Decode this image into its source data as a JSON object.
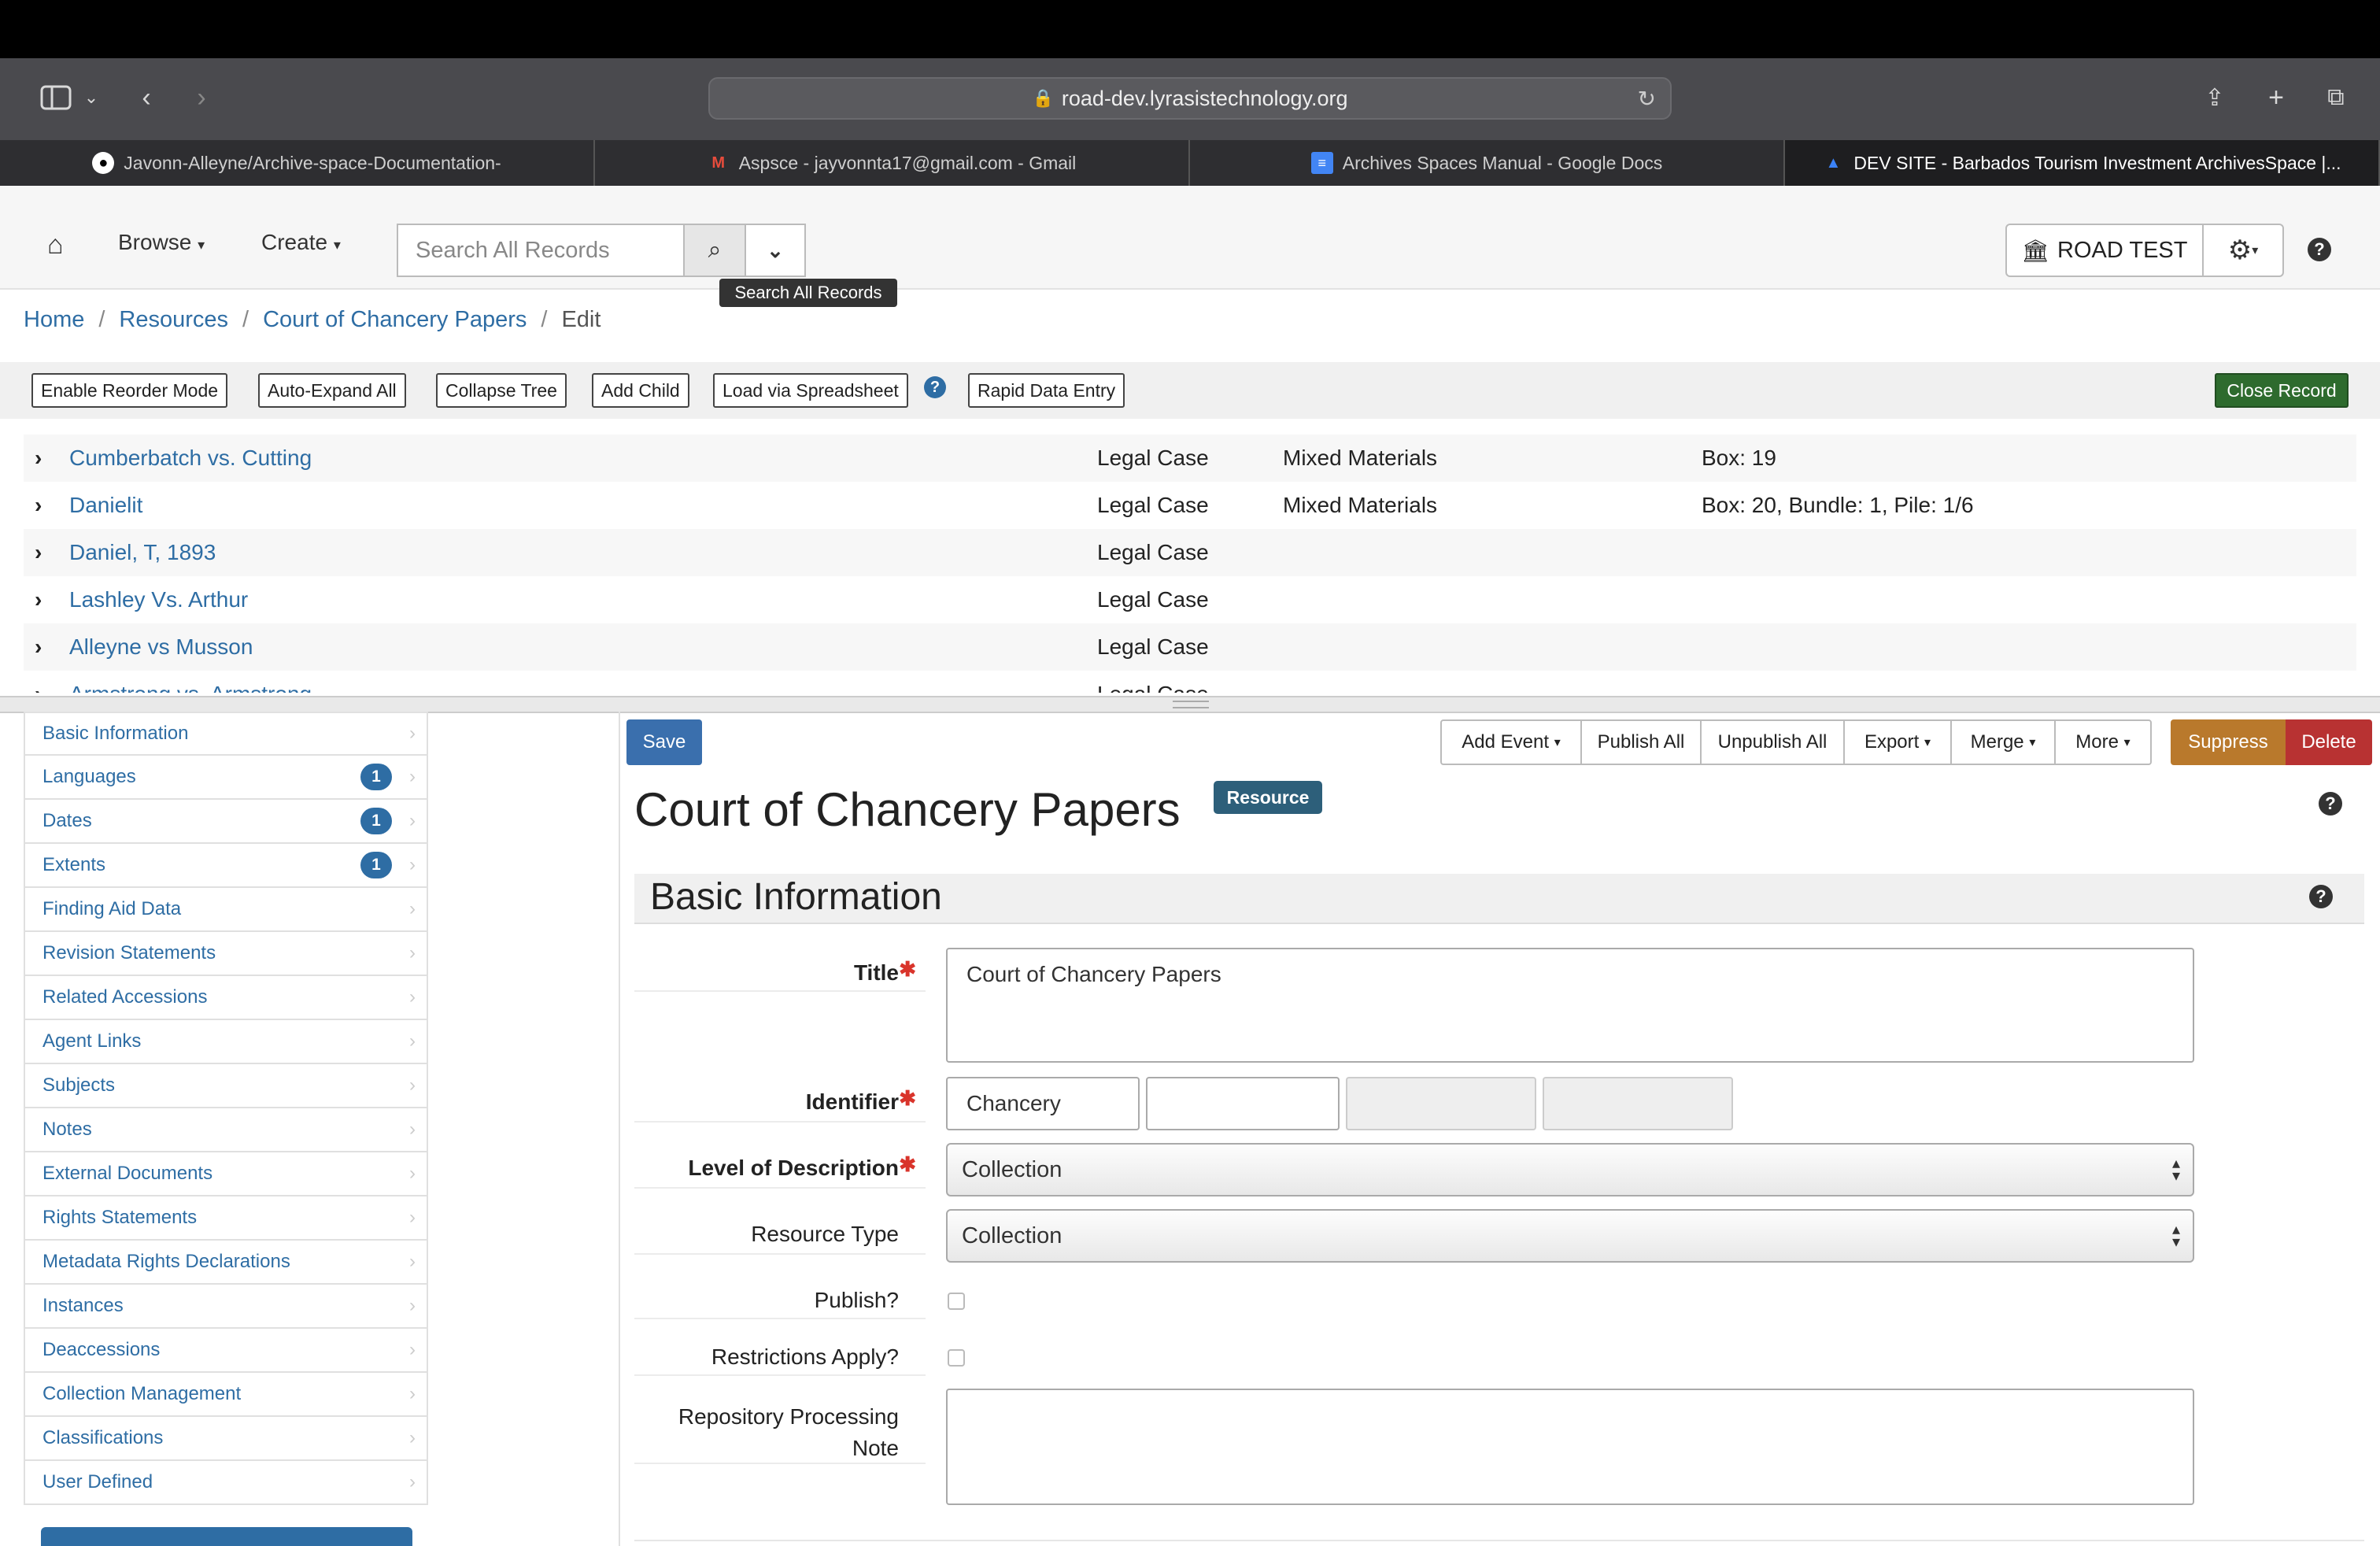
{
  "browser": {
    "url": "road-dev.lyrasistechnology.org",
    "tabs": [
      {
        "label": "Javonn-Alleyne/Archive-space-Documentation-",
        "icon": "github-icon"
      },
      {
        "label": "Aspsce - jayvonnta17@gmail.com - Gmail",
        "icon": "gmail-icon"
      },
      {
        "label": "Archives Spaces Manual - Google Docs",
        "icon": "google-docs-icon"
      },
      {
        "label": "DEV SITE - Barbados Tourism Investment ArchivesSpace |...",
        "icon": "archivesspace-icon",
        "active": true
      }
    ]
  },
  "navbar": {
    "browse": "Browse",
    "create": "Create",
    "search_placeholder": "Search All Records",
    "tooltip": "Search All Records",
    "repository": "ROAD TEST"
  },
  "breadcrumb": [
    "Home",
    "Resources",
    "Court of Chancery Papers",
    "Edit"
  ],
  "tree_toolbar": {
    "reorder": "Enable Reorder Mode",
    "expand": "Auto-Expand All",
    "collapse": "Collapse Tree",
    "add_child": "Add Child",
    "load": "Load via Spreadsheet",
    "rapid": "Rapid Data Entry",
    "close": "Close Record"
  },
  "tree": [
    {
      "title": "Cumberbatch vs. Cutting",
      "level": "Legal Case",
      "type": "Mixed Materials",
      "container": "Box: 19"
    },
    {
      "title": "Danielit",
      "level": "Legal Case",
      "type": "Mixed Materials",
      "container": "Box: 20, Bundle: 1, Pile: 1/6"
    },
    {
      "title": "Daniel, T, 1893",
      "level": "Legal Case",
      "type": "",
      "container": ""
    },
    {
      "title": "Lashley Vs. Arthur",
      "level": "Legal Case",
      "type": "",
      "container": ""
    },
    {
      "title": "Alleyne vs Musson",
      "level": "Legal Case",
      "type": "",
      "container": ""
    },
    {
      "title": "Armstrong vs. Armstrong",
      "level": "Legal Case",
      "type": "",
      "container": ""
    }
  ],
  "sidebar": [
    {
      "label": "Basic Information",
      "badge": ""
    },
    {
      "label": "Languages",
      "badge": "1"
    },
    {
      "label": "Dates",
      "badge": "1"
    },
    {
      "label": "Extents",
      "badge": "1"
    },
    {
      "label": "Finding Aid Data",
      "badge": ""
    },
    {
      "label": "Revision Statements",
      "badge": ""
    },
    {
      "label": "Related Accessions",
      "badge": ""
    },
    {
      "label": "Agent Links",
      "badge": ""
    },
    {
      "label": "Subjects",
      "badge": ""
    },
    {
      "label": "Notes",
      "badge": ""
    },
    {
      "label": "External Documents",
      "badge": ""
    },
    {
      "label": "Rights Statements",
      "badge": ""
    },
    {
      "label": "Metadata Rights Declarations",
      "badge": ""
    },
    {
      "label": "Instances",
      "badge": ""
    },
    {
      "label": "Deaccessions",
      "badge": ""
    },
    {
      "label": "Collection Management",
      "badge": ""
    },
    {
      "label": "Classifications",
      "badge": ""
    },
    {
      "label": "User Defined",
      "badge": ""
    }
  ],
  "form_toolbar": {
    "save": "Save",
    "add_event": "Add Event",
    "publish_all": "Publish All",
    "unpublish_all": "Unpublish All",
    "export": "Export",
    "merge": "Merge",
    "more": "More",
    "suppress": "Suppress",
    "delete": "Delete"
  },
  "record": {
    "title": "Court of Chancery Papers",
    "type_badge": "Resource",
    "section": "Basic Information"
  },
  "form": {
    "title_label": "Title",
    "title_value": "Court of Chancery Papers",
    "identifier_label": "Identifier",
    "identifier_values": [
      "Chancery",
      "",
      "",
      ""
    ],
    "level_label": "Level of Description",
    "level_value": "Collection",
    "resource_type_label": "Resource Type",
    "resource_type_value": "Collection",
    "publish_label": "Publish?",
    "publish_checked": false,
    "restrictions_label": "Restrictions Apply?",
    "restrictions_checked": false,
    "processing_note_label_1": "Repository Processing",
    "processing_note_label_2": "Note",
    "processing_note_value": ""
  },
  "colors": {
    "link": "#2e6da4",
    "save": "#3a6fad",
    "suppress": "#b9792c",
    "delete": "#b83232",
    "close": "#2e6b2e",
    "badge": "#2d5f7a"
  }
}
